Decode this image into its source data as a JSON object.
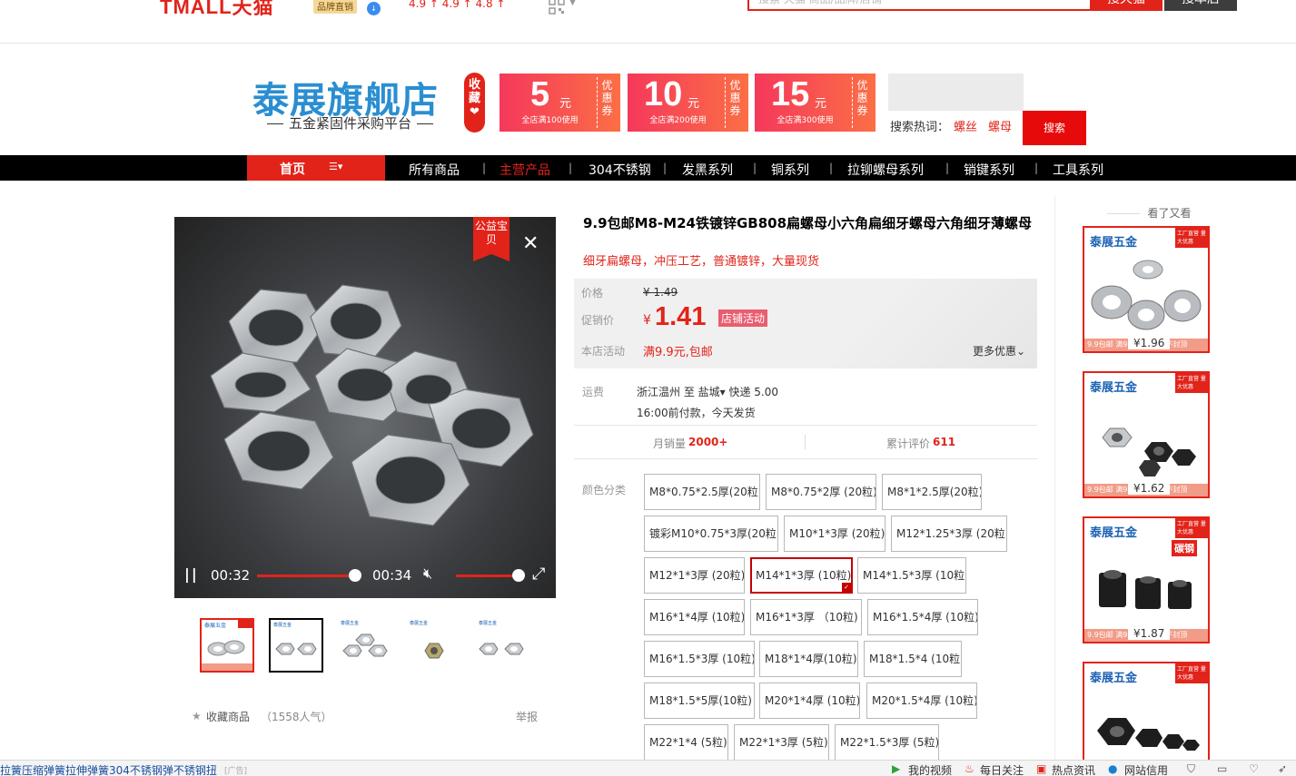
{
  "topbar": {
    "logo": "TMALL天猫",
    "brand_badge": "品牌直销",
    "scores": "4.9 ↑  4.9 ↑  4.8 ↑",
    "search_placeholder": "搜索 天猫 商品/品牌/店铺",
    "search_tmall": "搜天猫",
    "search_shop": "搜本店"
  },
  "shop": {
    "name": "泰展旗舰店",
    "slogan": "五金紧固件采购平台",
    "collect": "收藏❤",
    "coupons": [
      {
        "amount": "5",
        "unit": "元",
        "condition": "全店满100使用",
        "tag": "优惠券"
      },
      {
        "amount": "10",
        "unit": "元",
        "condition": "全店满200使用",
        "tag": "优惠券"
      },
      {
        "amount": "15",
        "unit": "元",
        "condition": "全店满300使用",
        "tag": "优惠券"
      }
    ],
    "hot_label": "搜索热词：",
    "hot_keywords": [
      "螺丝",
      "螺母"
    ],
    "search_button": "搜索"
  },
  "nav": {
    "home": "首页",
    "menu_icon": "☰▾",
    "items": [
      "所有商品",
      "主营产品",
      "304不锈钢",
      "发黑系列",
      "铜系列",
      "拉铆螺母系列",
      "销键系列",
      "工具系列"
    ],
    "active_color": "#e2231a"
  },
  "gallery": {
    "badge": "公益宝贝",
    "time_current": "00:32",
    "time_total": "00:34",
    "progress": 0.94,
    "volume": 0.9,
    "collect_label": "收藏商品",
    "collect_popularity": "（1558人气）",
    "report": "举报",
    "thumb_count": 5,
    "selected_thumb": 1
  },
  "product": {
    "title": "9.9包邮M8-M24铁镀锌GB808扁螺母小六角扁细牙螺母六角细牙薄螺母",
    "subtitle": "细牙扁螺母，冲压工艺，普通镀锌，大量现货",
    "price_label": "价格",
    "original_price": "¥ 1.49",
    "promo_label": "促销价",
    "currency": "¥",
    "promo_price": "1.41",
    "promo_tag": "店铺活动",
    "activity_label": "本店活动",
    "activity_value": "满9.9元,包邮",
    "more_discount": "更多优惠",
    "shipping_label": "运费",
    "ship_from": "浙江温州  至 盐城▾  快递 5.00",
    "ship_note": "16:00前付款，今天发货",
    "monthly_label": "月销量",
    "monthly_value": "2000+",
    "reviews_label": "累计评价",
    "reviews_value": "611",
    "color_label": "颜色分类",
    "skus": [
      "M8*0.75*2.5厚(20粒)",
      "M8*0.75*2厚 (20粒)",
      "M8*1*2.5厚(20粒)",
      "镀彩M10*0.75*3厚(20粒)",
      "M10*1*3厚 (20粒)",
      "M12*1.25*3厚 (20粒)",
      "M12*1*3厚 (20粒)",
      "M14*1*3厚 (10粒)",
      "M14*1.5*3厚 (10粒)",
      "M16*1*4厚 (10粒)",
      "M16*1*3厚 （10粒)",
      "M16*1.5*4厚 (10粒)",
      "M16*1.5*3厚 (10粒)",
      "M18*1*4厚(10粒)",
      "M18*1.5*4 (10粒)",
      "M18*1.5*5厚(10粒)",
      "M20*1*4厚 (10粒)",
      "M20*1.5*4厚 (10粒)",
      "M22*1*4 (5粒)",
      "M22*1*3厚 (5粒)",
      "M22*1.5*3厚 (5粒)"
    ],
    "selected_sku": "M14*1*3厚 (10粒)"
  },
  "side": {
    "title": "看了又看",
    "items": [
      {
        "logo": "泰展五金",
        "price": "¥1.96",
        "foot": "9.9包邮 满9.9元包邮 上不封顶"
      },
      {
        "logo": "泰展五金",
        "price": "¥1.62",
        "foot": "9.9包邮 满9.9元包邮 上不封顶"
      },
      {
        "logo": "泰展五金",
        "price": "¥1.87",
        "foot": "9.9包邮 满9.9元包邮 上不封顶"
      },
      {
        "logo": "泰展五金",
        "price": "",
        "foot": ""
      }
    ],
    "corner_text": "工厂直营 量大优惠",
    "item3_tag": "碳钢"
  },
  "statusbar": {
    "news": "拉簧压缩弹簧拉伸弹簧304不锈钢弹不锈钢扭",
    "ad": "[广告]",
    "items": [
      "我的视频",
      "每日关注",
      "热点资讯",
      "网站信用"
    ]
  }
}
